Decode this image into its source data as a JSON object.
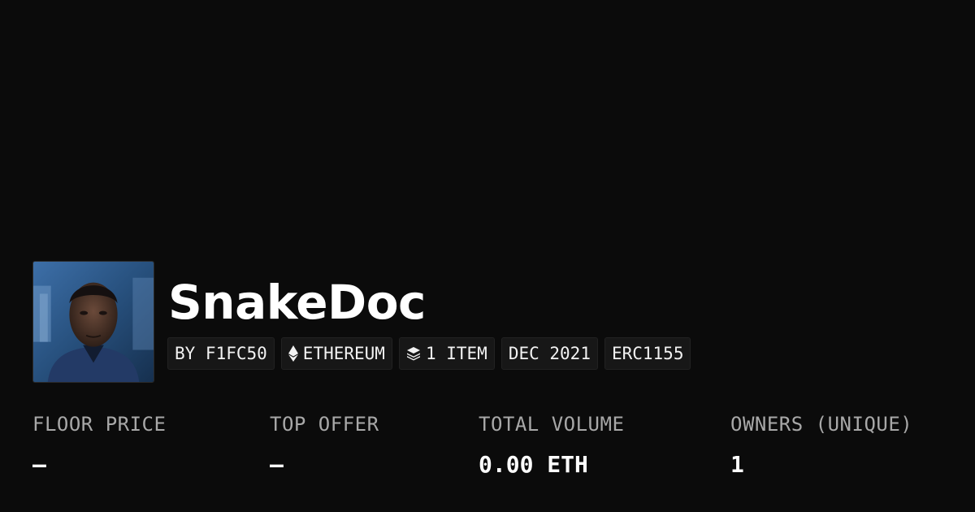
{
  "collection": {
    "name": "SnakeDoc",
    "avatar_alt": "collection-avatar"
  },
  "chips": [
    {
      "label": "BY F1FC50",
      "icon": ""
    },
    {
      "label": "ETHEREUM",
      "icon": "ethereum-icon"
    },
    {
      "label": "1 ITEM",
      "icon": "layers-icon"
    },
    {
      "label": "DEC 2021",
      "icon": ""
    },
    {
      "label": "ERC1155",
      "icon": ""
    }
  ],
  "stats": [
    {
      "label": "FLOOR PRICE",
      "value": "–"
    },
    {
      "label": "TOP OFFER",
      "value": "–"
    },
    {
      "label": "TOTAL VOLUME",
      "value": "0.00 ETH"
    },
    {
      "label": "OWNERS (UNIQUE)",
      "value": "1"
    }
  ],
  "colors": {
    "background": "#0b0b0b",
    "chip_background": "#171717",
    "label": "#a8a8a8",
    "text": "#ffffff"
  }
}
